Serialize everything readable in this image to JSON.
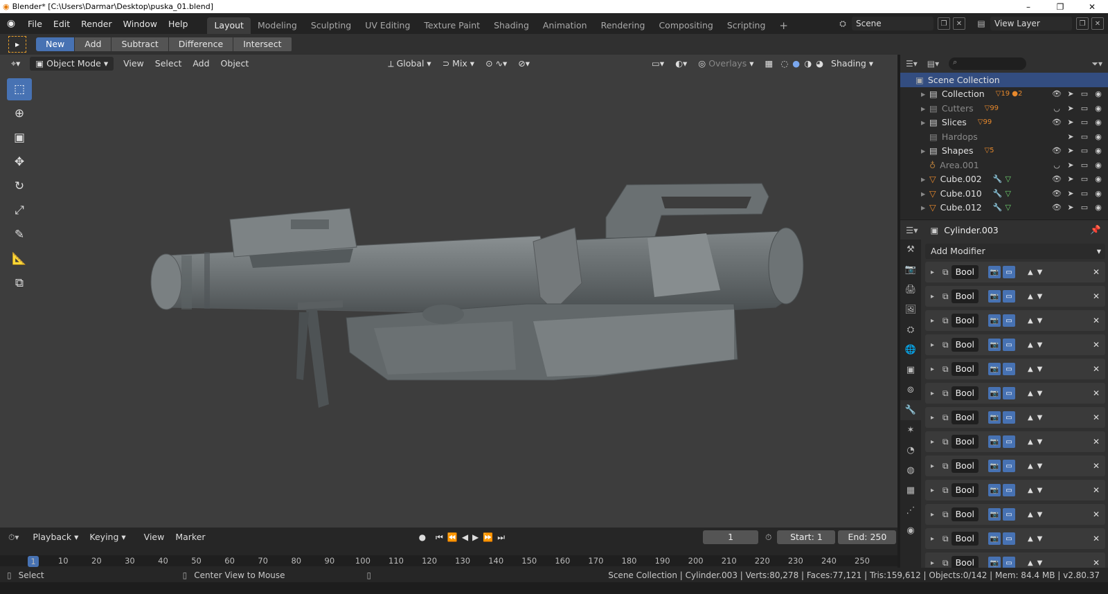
{
  "window": {
    "title": "Blender* [C:\\Users\\Darmar\\Desktop\\puska_01.blend]",
    "controls": [
      "–",
      "❐",
      "✕"
    ]
  },
  "menu": {
    "logo": "◉",
    "items": [
      "File",
      "Edit",
      "Render",
      "Window",
      "Help"
    ],
    "tabs": [
      "Layout",
      "Modeling",
      "Sculpting",
      "UV Editing",
      "Texture Paint",
      "Shading",
      "Animation",
      "Rendering",
      "Compositing",
      "Scripting"
    ],
    "add_tab": "+",
    "scene": "Scene",
    "view_layer": "View Layer"
  },
  "tool_options": {
    "buttons": [
      "New",
      "Add",
      "Subtract",
      "Difference",
      "Intersect"
    ]
  },
  "viewport_header": {
    "mode": "Object Mode",
    "menus": [
      "View",
      "Select",
      "Add",
      "Object"
    ],
    "transform": "Global",
    "snap": "Mix",
    "overlays": "Overlays",
    "shading": "Shading"
  },
  "outliner": {
    "root": "Scene Collection",
    "rows": [
      {
        "name": "Collection",
        "badge": "19",
        "badge2": "2",
        "dim": false
      },
      {
        "name": "Cutters",
        "badge": "99",
        "badge2": "",
        "dim": true
      },
      {
        "name": "Slices",
        "badge": "99",
        "badge2": "",
        "dim": false
      },
      {
        "name": "Hardops",
        "badge": "",
        "badge2": "",
        "dim": true
      },
      {
        "name": "Shapes",
        "badge": "5",
        "badge2": "",
        "dim": false
      },
      {
        "name": "Area.001",
        "badge": "",
        "badge2": "",
        "dim": true
      },
      {
        "name": "Cube.002",
        "badge": "",
        "badge2": "",
        "dim": false
      },
      {
        "name": "Cube.010",
        "badge": "",
        "badge2": "",
        "dim": false
      },
      {
        "name": "Cube.012",
        "badge": "",
        "badge2": "",
        "dim": false
      }
    ]
  },
  "properties": {
    "object": "Cylinder.003",
    "add_modifier": "Add Modifier",
    "modifiers": [
      "Bool",
      "Bool",
      "Bool",
      "Bool",
      "Bool",
      "Bool",
      "Bool",
      "Bool",
      "Bool",
      "Bool",
      "Bool",
      "Bool",
      "Bool"
    ]
  },
  "timeline": {
    "menus": [
      "Playback",
      "Keying",
      "View",
      "Marker"
    ],
    "current_frame": "1",
    "start_label": "Start:",
    "start": "1",
    "end_label": "End:",
    "end": "250",
    "ticks": [
      "1",
      "10",
      "20",
      "30",
      "40",
      "50",
      "60",
      "70",
      "80",
      "90",
      "100",
      "110",
      "120",
      "130",
      "140",
      "150",
      "160",
      "170",
      "180",
      "190",
      "200",
      "210",
      "220",
      "230",
      "240",
      "250"
    ]
  },
  "status": {
    "left": "Select",
    "middle": "Center View to Mouse",
    "right": "Scene Collection | Cylinder.003 | Verts:80,278 | Faces:77,121 | Tris:159,612 | Objects:0/142 | Mem: 84.4 MB | v2.80.37"
  },
  "colors": {
    "accent": "#4772b3",
    "selected_row": "#334d80",
    "object_orange": "#e8892c"
  }
}
